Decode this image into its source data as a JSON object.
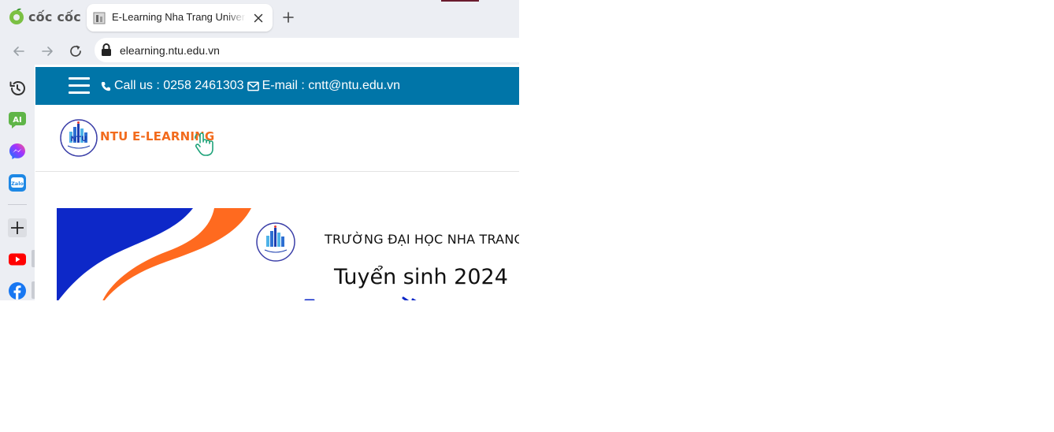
{
  "browser": {
    "brand": "cốc cốc",
    "tab": {
      "title": "E-Learning Nha Trang University"
    },
    "address": {
      "url": "elearning.ntu.edu.vn"
    }
  },
  "sidebar": {
    "items": [
      {
        "name": "history-icon"
      },
      {
        "name": "ai-assistant-icon",
        "label": "AI"
      },
      {
        "name": "messenger-icon"
      },
      {
        "name": "zalo-icon",
        "label": "Zalo"
      },
      {
        "name": "add-icon"
      },
      {
        "name": "youtube-icon"
      },
      {
        "name": "facebook-icon"
      }
    ]
  },
  "page": {
    "topbar": {
      "background": "#0075a8",
      "phone_label": "Call us : 0258 2461303",
      "email_label": "E-mail : cntt@ntu.edu.vn"
    },
    "header": {
      "logo_badge_text": "NTU",
      "logo_text": "NTU E-LEARNING",
      "accent": "#f26b1d"
    },
    "banner": {
      "school": "TRƯỜNG ĐẠI HỌC NHA TRANG",
      "headline": "Tuyển sinh 2024",
      "colors": {
        "blue": "#0d28c8",
        "orange": "#ff6a1f"
      }
    }
  }
}
